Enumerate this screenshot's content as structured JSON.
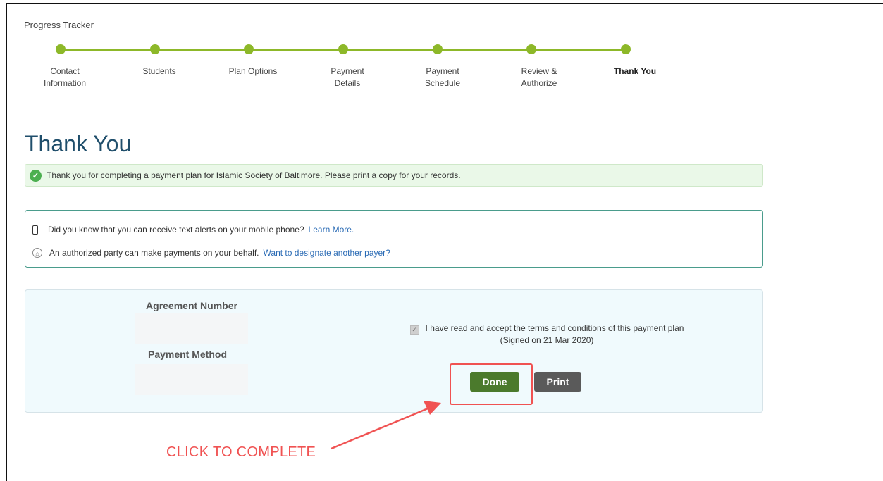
{
  "tracker": {
    "title": "Progress Tracker",
    "steps": [
      {
        "label": "Contact\nInformation"
      },
      {
        "label": "Students"
      },
      {
        "label": "Plan Options"
      },
      {
        "label": "Payment\nDetails"
      },
      {
        "label": "Payment\nSchedule"
      },
      {
        "label": "Review &\nAuthorize"
      },
      {
        "label": "Thank You",
        "active": true
      }
    ]
  },
  "page_title": "Thank You",
  "success_alert": "Thank you for completing a payment plan for Islamic Society of Baltimore. Please print a copy for your records.",
  "info": {
    "text_alerts": "Did you know that you can receive text alerts on your mobile phone?",
    "text_alerts_link": "Learn More.",
    "authorized_party": "An authorized party can make payments on your behalf.",
    "authorized_party_link": "Want to designate another payer?"
  },
  "summary": {
    "agreement_number_label": "Agreement Number",
    "payment_method_label": "Payment Method",
    "terms_text": "I have read and accept the terms and conditions of this payment plan",
    "signed_text": "(Signed on 21 Mar 2020)",
    "done_label": "Done",
    "print_label": "Print"
  },
  "annotation": "CLICK TO COMPLETE",
  "colors": {
    "progress": "#8db829",
    "title": "#1f4e6b",
    "done": "#4b7a2c",
    "annotation": "#f05252"
  }
}
